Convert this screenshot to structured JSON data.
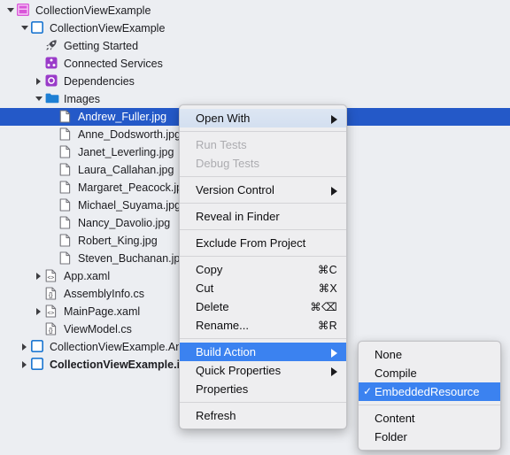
{
  "tree": {
    "items": [
      {
        "label": "CollectionViewExample",
        "indent": 0,
        "twisty": "expanded",
        "icon": "solution-icon",
        "bold": false,
        "selected": false
      },
      {
        "label": "CollectionViewExample",
        "indent": 1,
        "twisty": "expanded",
        "icon": "project-icon",
        "bold": false,
        "selected": false
      },
      {
        "label": "Getting Started",
        "indent": 2,
        "twisty": "none",
        "icon": "rocket-icon",
        "bold": false,
        "selected": false
      },
      {
        "label": "Connected Services",
        "indent": 2,
        "twisty": "none",
        "icon": "connected-services-icon",
        "bold": false,
        "selected": false
      },
      {
        "label": "Dependencies",
        "indent": 2,
        "twisty": "collapsed",
        "icon": "dependencies-icon",
        "bold": false,
        "selected": false
      },
      {
        "label": "Images",
        "indent": 2,
        "twisty": "expanded",
        "icon": "folder-icon",
        "bold": false,
        "selected": false
      },
      {
        "label": "Andrew_Fuller.jpg",
        "indent": 3,
        "twisty": "none",
        "icon": "file-icon",
        "bold": false,
        "selected": true
      },
      {
        "label": "Anne_Dodsworth.jpg",
        "indent": 3,
        "twisty": "none",
        "icon": "file-icon",
        "bold": false,
        "selected": false
      },
      {
        "label": "Janet_Leverling.jpg",
        "indent": 3,
        "twisty": "none",
        "icon": "file-icon",
        "bold": false,
        "selected": false
      },
      {
        "label": "Laura_Callahan.jpg",
        "indent": 3,
        "twisty": "none",
        "icon": "file-icon",
        "bold": false,
        "selected": false
      },
      {
        "label": "Margaret_Peacock.jpg",
        "indent": 3,
        "twisty": "none",
        "icon": "file-icon",
        "bold": false,
        "selected": false
      },
      {
        "label": "Michael_Suyama.jpg",
        "indent": 3,
        "twisty": "none",
        "icon": "file-icon",
        "bold": false,
        "selected": false
      },
      {
        "label": "Nancy_Davolio.jpg",
        "indent": 3,
        "twisty": "none",
        "icon": "file-icon",
        "bold": false,
        "selected": false
      },
      {
        "label": "Robert_King.jpg",
        "indent": 3,
        "twisty": "none",
        "icon": "file-icon",
        "bold": false,
        "selected": false
      },
      {
        "label": "Steven_Buchanan.jpg",
        "indent": 3,
        "twisty": "none",
        "icon": "file-icon",
        "bold": false,
        "selected": false
      },
      {
        "label": "App.xaml",
        "indent": 2,
        "twisty": "collapsed",
        "icon": "xaml-icon",
        "bold": false,
        "selected": false
      },
      {
        "label": "AssemblyInfo.cs",
        "indent": 2,
        "twisty": "none",
        "icon": "csharp-icon",
        "bold": false,
        "selected": false
      },
      {
        "label": "MainPage.xaml",
        "indent": 2,
        "twisty": "collapsed",
        "icon": "xaml-icon",
        "bold": false,
        "selected": false
      },
      {
        "label": "ViewModel.cs",
        "indent": 2,
        "twisty": "none",
        "icon": "csharp-icon",
        "bold": false,
        "selected": false
      },
      {
        "label": "CollectionViewExample.Android",
        "indent": 1,
        "twisty": "collapsed",
        "icon": "project-icon",
        "bold": false,
        "selected": false
      },
      {
        "label": "CollectionViewExample.iOS",
        "indent": 1,
        "twisty": "collapsed",
        "icon": "project-icon",
        "bold": true,
        "selected": false
      }
    ]
  },
  "context_menu": {
    "groups": [
      {
        "items": [
          {
            "label": "Open With",
            "shortcut": "",
            "state": "hover",
            "submenu": true
          }
        ]
      },
      {
        "items": [
          {
            "label": "Run Tests",
            "shortcut": "",
            "state": "disabled",
            "submenu": false
          },
          {
            "label": "Debug Tests",
            "shortcut": "",
            "state": "disabled",
            "submenu": false
          }
        ]
      },
      {
        "items": [
          {
            "label": "Version Control",
            "shortcut": "",
            "state": "normal",
            "submenu": true
          }
        ]
      },
      {
        "items": [
          {
            "label": "Reveal in Finder",
            "shortcut": "",
            "state": "normal",
            "submenu": false
          }
        ]
      },
      {
        "items": [
          {
            "label": "Exclude From Project",
            "shortcut": "",
            "state": "normal",
            "submenu": false
          }
        ]
      },
      {
        "items": [
          {
            "label": "Copy",
            "shortcut": "⌘C",
            "state": "normal",
            "submenu": false
          },
          {
            "label": "Cut",
            "shortcut": "⌘X",
            "state": "normal",
            "submenu": false
          },
          {
            "label": "Delete",
            "shortcut": "⌘⌫",
            "state": "normal",
            "submenu": false
          },
          {
            "label": "Rename...",
            "shortcut": "⌘R",
            "state": "normal",
            "submenu": false
          }
        ]
      },
      {
        "items": [
          {
            "label": "Build Action",
            "shortcut": "",
            "state": "highlight",
            "submenu": true
          },
          {
            "label": "Quick Properties",
            "shortcut": "",
            "state": "normal",
            "submenu": true
          },
          {
            "label": "Properties",
            "shortcut": "",
            "state": "normal",
            "submenu": false
          }
        ]
      },
      {
        "items": [
          {
            "label": "Refresh",
            "shortcut": "",
            "state": "normal",
            "submenu": false
          }
        ]
      }
    ]
  },
  "build_action_submenu": {
    "groups": [
      {
        "items": [
          {
            "label": "None",
            "checked": false,
            "state": "normal"
          },
          {
            "label": "Compile",
            "checked": false,
            "state": "normal"
          },
          {
            "label": "EmbeddedResource",
            "checked": true,
            "state": "highlight"
          }
        ]
      },
      {
        "items": [
          {
            "label": "Content",
            "checked": false,
            "state": "normal"
          },
          {
            "label": "Folder",
            "checked": false,
            "state": "normal"
          }
        ]
      }
    ]
  },
  "colors": {
    "selection_blue": "#2459c8",
    "menu_highlight_blue": "#3b82f0",
    "tree_background": "#eceef2",
    "menu_background": "#eeeef0",
    "solution_icon": "#d957d9",
    "project_icon": "#1f78d1",
    "folder_icon": "#1e7fd4",
    "connected_services_icon": "#9a3bc9",
    "dependencies_icon": "#9a3bc9"
  },
  "check_glyph": "✓"
}
